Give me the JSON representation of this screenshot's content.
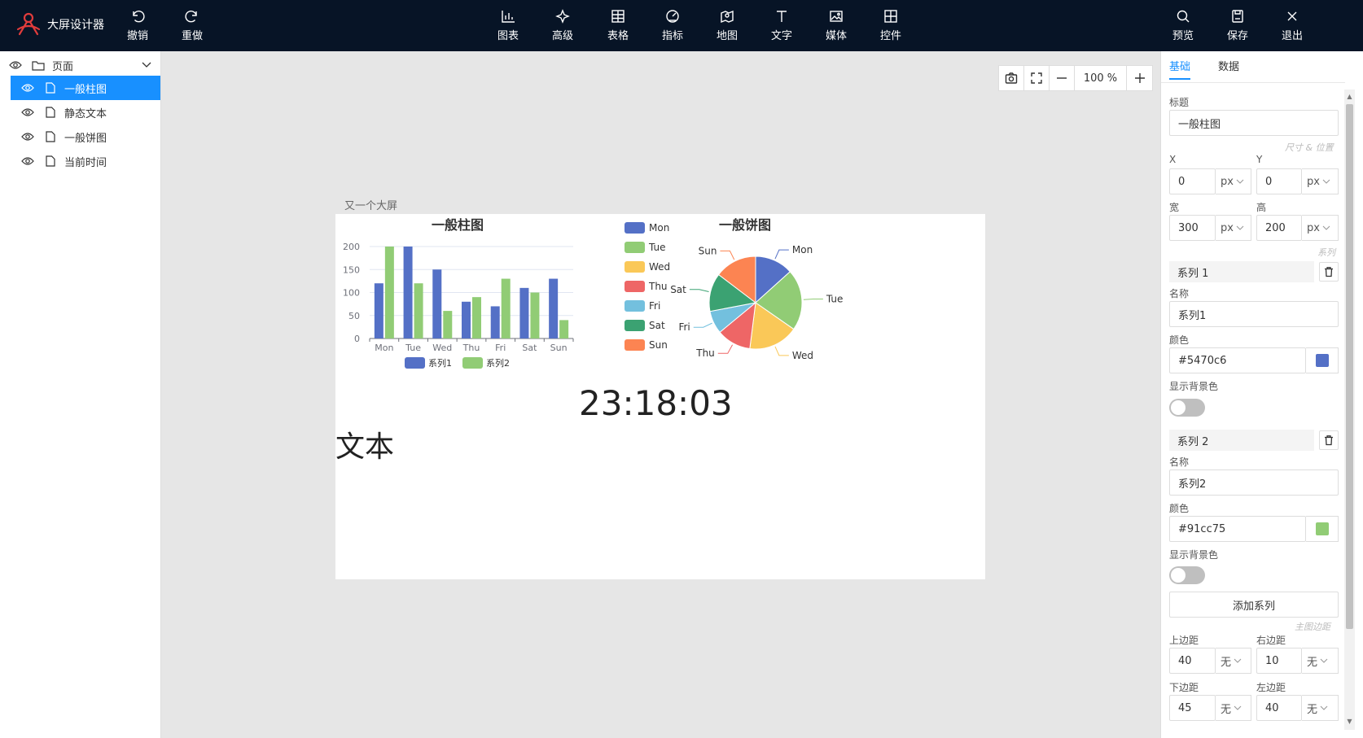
{
  "app": {
    "title": "大屏设计器"
  },
  "toolbar": {
    "undo": "撤销",
    "redo": "重做",
    "chart": "图表",
    "advanced": "高级",
    "table": "表格",
    "indicator": "指标",
    "map": "地图",
    "text": "文字",
    "media": "媒体",
    "widget": "控件",
    "preview": "预览",
    "save": "保存",
    "exit": "退出"
  },
  "layers": {
    "root": "页面",
    "items": [
      "一般柱图",
      "静态文本",
      "一般饼图",
      "当前时间"
    ],
    "selected_index": 0
  },
  "zoom": {
    "value": "100 %"
  },
  "screen": {
    "title": "又一个大屏",
    "clock": "23:18:03",
    "static_text": "文本"
  },
  "chart_data": [
    {
      "type": "bar",
      "title": "一般柱图",
      "categories": [
        "Mon",
        "Tue",
        "Wed",
        "Thu",
        "Fri",
        "Sat",
        "Sun"
      ],
      "series": [
        {
          "name": "系列1",
          "color": "#5470c6",
          "values": [
            120,
            200,
            150,
            80,
            70,
            110,
            130
          ]
        },
        {
          "name": "系列2",
          "color": "#91cc75",
          "values": [
            200,
            120,
            60,
            90,
            130,
            100,
            40
          ]
        }
      ],
      "ylim": [
        0,
        200
      ],
      "yticks": [
        "0",
        "50",
        "100",
        "150",
        "200"
      ],
      "legend": "bottom",
      "grid": true
    },
    {
      "type": "pie",
      "title": "一般饼图",
      "legend": "left",
      "slices": [
        {
          "label": "Mon",
          "value": 1,
          "color": "#5470c6"
        },
        {
          "label": "Tue",
          "value": 1.6,
          "color": "#91cc75"
        },
        {
          "label": "Wed",
          "value": 1.3,
          "color": "#fac858"
        },
        {
          "label": "Thu",
          "value": 0.9,
          "color": "#ee6666"
        },
        {
          "label": "Fri",
          "value": 0.6,
          "color": "#73c0de"
        },
        {
          "label": "Sat",
          "value": 1.0,
          "color": "#3ba272"
        },
        {
          "label": "Sun",
          "value": 1.1,
          "color": "#fc8452"
        }
      ]
    }
  ],
  "props": {
    "tab_basic": "基础",
    "tab_data": "数据",
    "title_label": "标题",
    "title_value": "一般柱图",
    "section_size": "尺寸 & 位置",
    "x_label": "X",
    "x_value": "0",
    "x_unit": "px",
    "y_label": "Y",
    "y_value": "0",
    "y_unit": "px",
    "w_label": "宽",
    "w_value": "300",
    "w_unit": "px",
    "h_label": "高",
    "h_value": "200",
    "h_unit": "px",
    "section_series": "系列",
    "series": [
      {
        "head": "系列 1",
        "name_label": "名称",
        "name": "系列1",
        "color_label": "颜色",
        "color": "#5470c6",
        "bg_label": "显示背景色"
      },
      {
        "head": "系列 2",
        "name_label": "名称",
        "name": "系列2",
        "color_label": "颜色",
        "color": "#91cc75",
        "bg_label": "显示背景色"
      }
    ],
    "add_series": "添加系列",
    "section_margin": "主图边距",
    "top_label": "上边距",
    "top_value": "40",
    "top_unit": "无",
    "right_label": "右边距",
    "right_value": "10",
    "right_unit": "无",
    "bottom_label": "下边距",
    "bottom_value": "45",
    "bottom_unit": "无",
    "left_label": "左边距",
    "left_value": "40",
    "left_unit": "无"
  }
}
